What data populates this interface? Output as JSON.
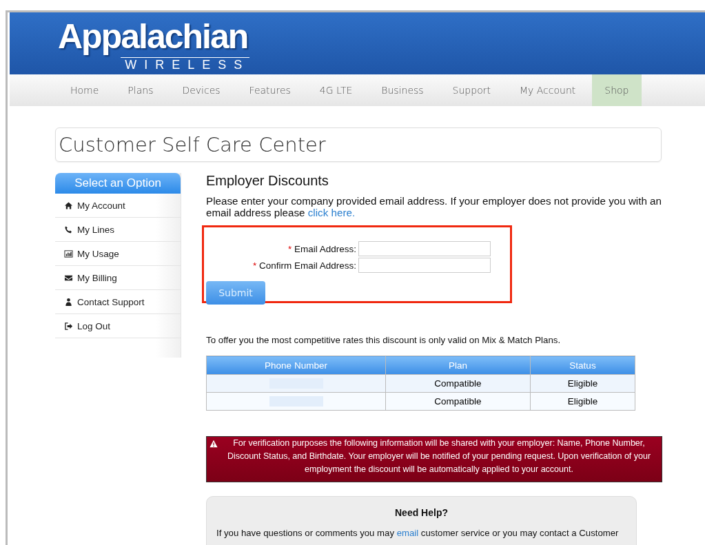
{
  "logo": {
    "name": "Appalachian",
    "tagline": "WIRELESS"
  },
  "nav": [
    {
      "label": "Home",
      "selected": false
    },
    {
      "label": "Plans",
      "selected": false
    },
    {
      "label": "Devices",
      "selected": false
    },
    {
      "label": "Features",
      "selected": false
    },
    {
      "label": "4G LTE",
      "selected": false
    },
    {
      "label": "Business",
      "selected": false
    },
    {
      "label": "Support",
      "selected": false
    },
    {
      "label": "My Account",
      "selected": false
    },
    {
      "label": "Shop",
      "selected": true
    }
  ],
  "page_title": "Customer Self Care Center",
  "sidebar": {
    "heading": "Select an Option",
    "items": [
      {
        "label": "My Account",
        "kind": "home"
      },
      {
        "label": "My Lines",
        "kind": "phone"
      },
      {
        "label": "My Usage",
        "kind": "chart"
      },
      {
        "label": "My Billing",
        "kind": "mail"
      },
      {
        "label": "Contact Support",
        "kind": "user"
      },
      {
        "label": "Log Out",
        "kind": "logout"
      }
    ]
  },
  "section_title": "Employer Discounts",
  "intro": "Please enter your company provided email address. If your employer does not provide you with an email address please ",
  "intro_link": "click here.",
  "form": {
    "required_mark": "*",
    "fields": [
      {
        "label": "Email Address:"
      },
      {
        "label": "Confirm Email Address:"
      }
    ],
    "submit": "Submit"
  },
  "note": "To offer you the most competitive rates this discount is only valid on Mix & Match Plans.",
  "table": {
    "columns": [
      "Phone Number",
      "Plan",
      "Status"
    ],
    "rows": [
      {
        "plan": "Compatible",
        "status": "Eligible"
      },
      {
        "plan": "Compatible",
        "status": "Eligible"
      }
    ]
  },
  "alert": "For verification purposes the following information will be shared with your employer: Name, Phone Number, Discount Status, and Birthdate. Your employer will be notified of your pending request. Upon verification of your employment the discount will be automatically applied to your account.",
  "help": {
    "title": "Need Help?",
    "text_before": "If you have questions or comments you may ",
    "link": "email",
    "text_after": " customer service or you may contact a Customer"
  }
}
